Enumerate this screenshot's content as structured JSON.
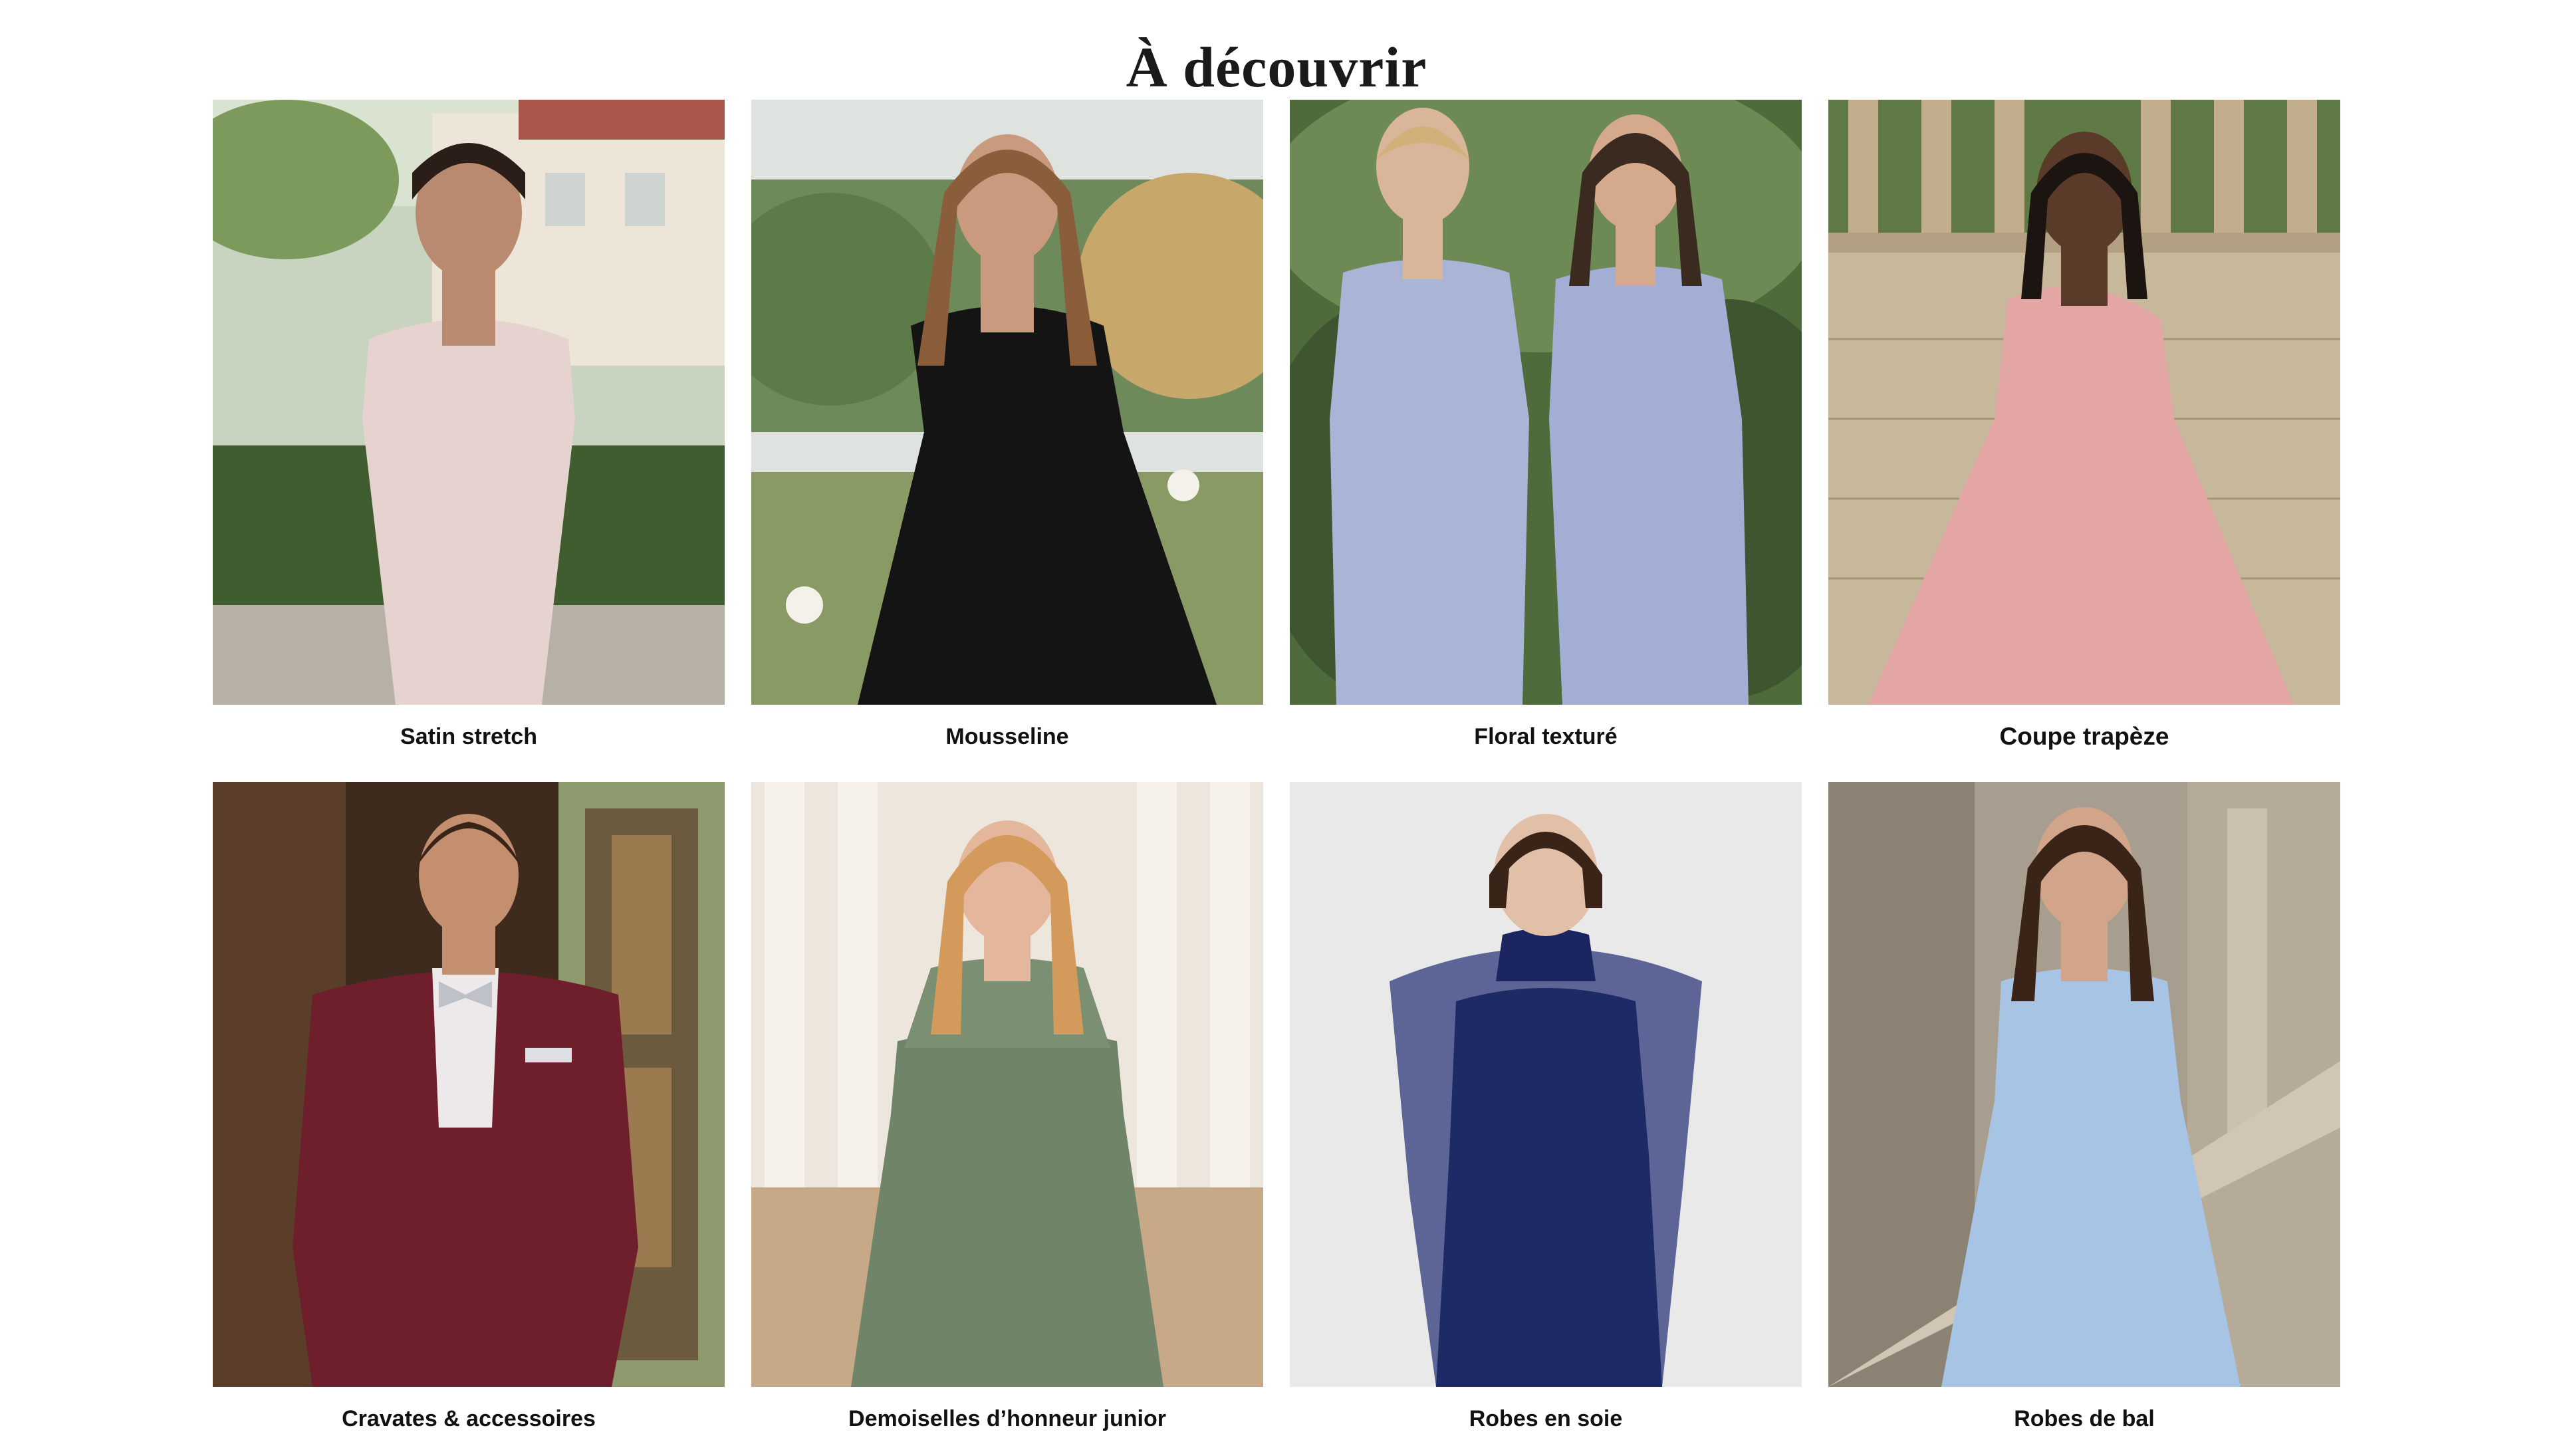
{
  "page_title": "À découvrir",
  "cards": [
    {
      "label": "Satin stretch",
      "image": "model in off-shoulder blush satin gown in garden",
      "dress_color": "#e6d3cf"
    },
    {
      "label": "Mousseline",
      "image": "model in black pleated chiffon gown",
      "dress_color": "#141414"
    },
    {
      "label": "Floral texturé",
      "image": "two models in lavender-blue textured gowns",
      "dress_color": "#a9b4d6"
    },
    {
      "label": "Coupe trapèze",
      "image": "model in pink one-shoulder A-line gown",
      "dress_color": "#e3a6a4"
    },
    {
      "label": "Cravates & accessoires",
      "image": "man in burgundy suit with silver bow tie",
      "dress_color": "#6e1f2b"
    },
    {
      "label": "Demoiselles d’honneur junior",
      "image": "girl in sage green halter dress",
      "dress_color": "#6f8468"
    },
    {
      "label": "Robes en soie",
      "image": "model in navy silk dress with sheer cape",
      "dress_color": "#1e2a66"
    },
    {
      "label": "Robes de bal",
      "image": "model in light blue jacquard gown on stone staircase",
      "dress_color": "#a8c4e4"
    }
  ]
}
